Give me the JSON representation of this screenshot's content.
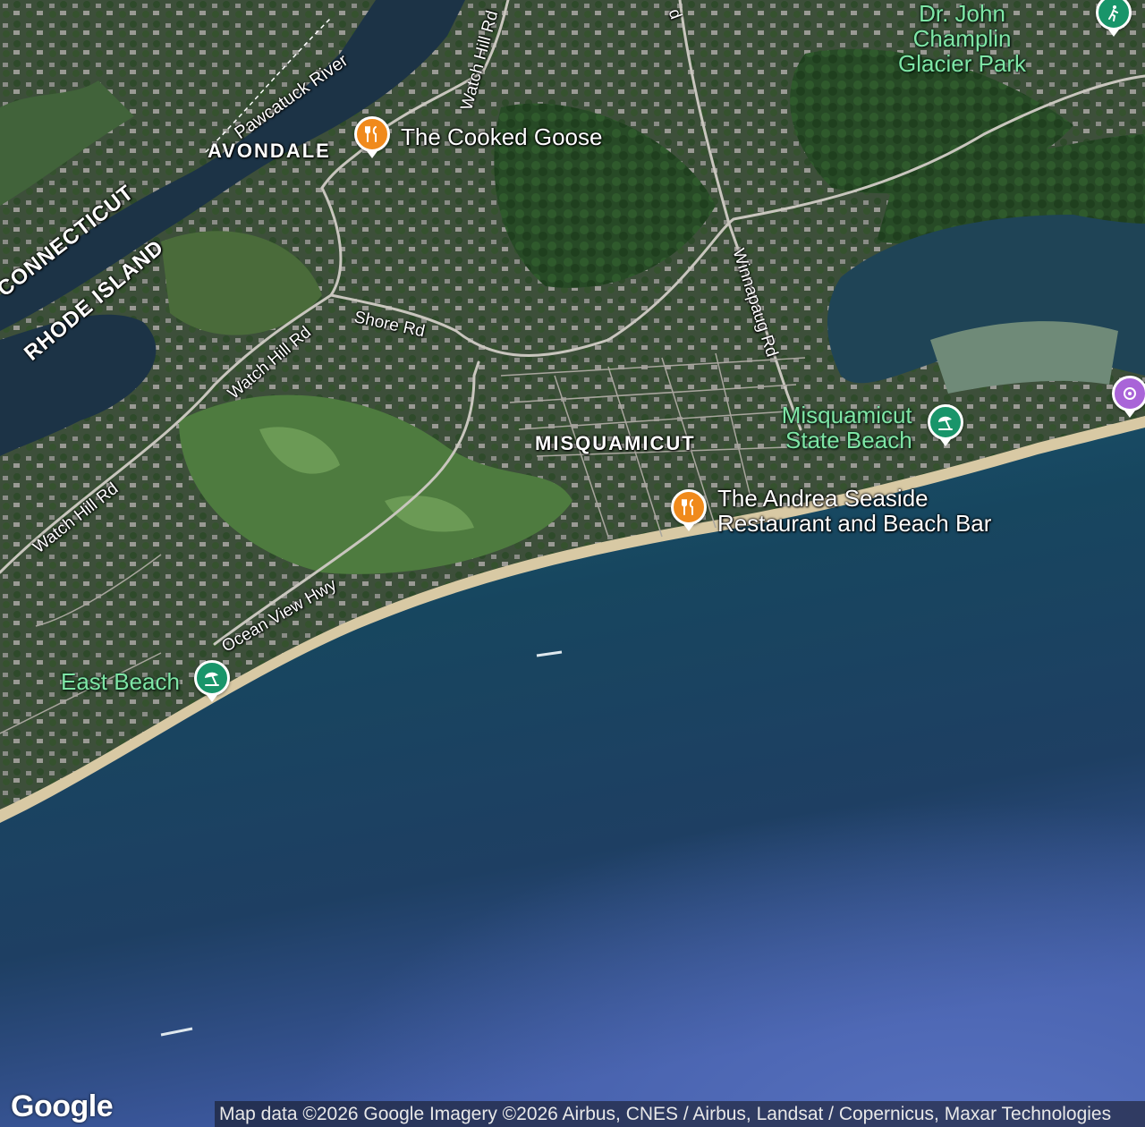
{
  "map": {
    "areas": {
      "avondale": "AVONDALE",
      "misquamicut": "MISQUAMICUT"
    },
    "states": {
      "connecticut": "CONNECTICUT",
      "rhode_island": "RHODE ISLAND"
    },
    "water": {
      "river": "Pawcatuck River"
    },
    "roads": {
      "watch_hill_top": "Watch Hill Rd",
      "watch_hill_mid": "Watch Hill Rd",
      "watch_hill_low": "Watch Hill Rd",
      "shore": "Shore Rd",
      "ocean_view": "Ocean View Hwy",
      "winnapaug": "Winnapaug Rd",
      "top_road_fragment": "d"
    },
    "pois": [
      {
        "name": "The Cooked Goose",
        "category": "restaurant",
        "icon": "fork-knife-icon",
        "color": "#f08a1c"
      },
      {
        "name": "The Andrea Seaside Restaurant and Beach Bar",
        "line1": "The Andrea Seaside",
        "line2": "Restaurant and Beach Bar",
        "category": "restaurant",
        "icon": "fork-knife-icon",
        "color": "#f08a1c"
      },
      {
        "name": "Misquamicut State Beach",
        "line1": "Misquamicut",
        "line2": "State Beach",
        "category": "beach",
        "icon": "beach-umbrella-icon",
        "color": "#19956a"
      },
      {
        "name": "East Beach",
        "category": "beach",
        "icon": "beach-umbrella-icon",
        "color": "#19956a"
      },
      {
        "name": "Dr. John Champlin Glacier Park",
        "line1": "Dr. John",
        "line2": "Champlin",
        "line3": "Glacier Park",
        "category": "park",
        "color": "#19956a"
      },
      {
        "category": "park",
        "icon": "hiking-icon",
        "color": "#19956a"
      },
      {
        "category": "attraction",
        "icon": "attraction-icon",
        "color": "#a964d8"
      }
    ]
  },
  "branding": {
    "logo": "Google"
  },
  "attribution": "Map data ©2026 Google Imagery ©2026 Airbus, CNES / Airbus, Landsat / Copernicus, Maxar Technologies"
}
